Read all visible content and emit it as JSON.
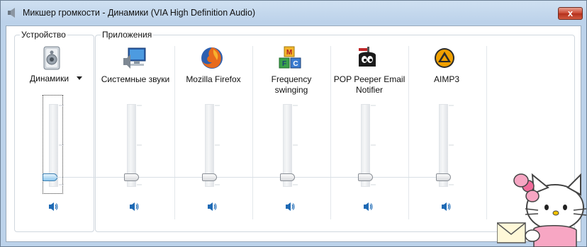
{
  "window": {
    "title": "Микшер громкости - Динамики (VIA High Definition Audio)",
    "close_label": "x"
  },
  "device": {
    "group_label": "Устройство",
    "name": "Динамики",
    "level_percent": 0
  },
  "apps": {
    "group_label": "Приложения",
    "items": [
      {
        "label": "Системные звуки",
        "icon": "system-sounds-icon",
        "level_percent": 0
      },
      {
        "label": "Mozilla Firefox",
        "icon": "firefox-icon",
        "level_percent": 0
      },
      {
        "label": "Frequency swinging",
        "icon": "frequency-swinging-icon",
        "level_percent": 0
      },
      {
        "label": "POP Peeper Email Notifier",
        "icon": "pop-peeper-icon",
        "level_percent": 0
      },
      {
        "label": "AIMP3",
        "icon": "aimp3-icon",
        "level_percent": 0
      }
    ]
  },
  "colors": {
    "accent": "#3c7fb1",
    "speaker": "#1e6ab5",
    "aimp": "#f0a000",
    "firefox": "#e76a1d"
  }
}
